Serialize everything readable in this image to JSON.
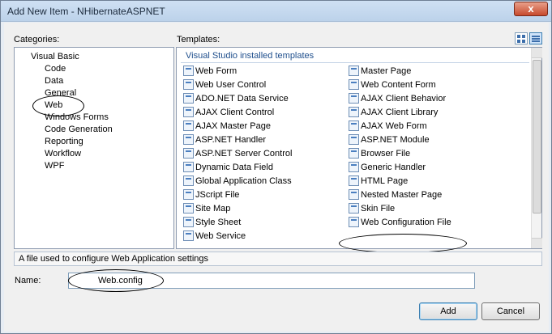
{
  "window": {
    "title": "Add New Item - NHibernateASPNET",
    "close_glyph": "x"
  },
  "categories": {
    "label": "Categories:",
    "root": "Visual Basic",
    "items": [
      "Code",
      "Data",
      "General",
      "Web",
      "Windows Forms",
      "Code Generation",
      "Reporting",
      "Workflow",
      "WPF"
    ],
    "selected": "Web"
  },
  "templates": {
    "label": "Templates:",
    "group_header": "Visual Studio installed templates",
    "left_column": [
      "Web Form",
      "Web User Control",
      "ADO.NET Data Service",
      "AJAX Client Control",
      "AJAX Master Page",
      "ASP.NET Handler",
      "ASP.NET Server Control",
      "Dynamic Data Field",
      "Global Application Class",
      "JScript File",
      "Site Map",
      "Style Sheet",
      "Web Service"
    ],
    "right_column": [
      "Master Page",
      "Web Content Form",
      "AJAX Client Behavior",
      "AJAX Client Library",
      "AJAX Web Form",
      "ASP.NET Module",
      "Browser File",
      "Generic Handler",
      "HTML Page",
      "Nested Master Page",
      "Skin File",
      "Web Configuration File"
    ],
    "selected": "Web Configuration File"
  },
  "description": "A file used to configure Web Application settings",
  "name_field": {
    "label": "Name:",
    "value": "Web.config"
  },
  "buttons": {
    "add": "Add",
    "cancel": "Cancel"
  },
  "icons": {
    "close": "close-icon",
    "large-icons-view": "large-icons-view-icon",
    "small-icons-view": "small-icons-view-icon",
    "template": "template-file-icon"
  }
}
